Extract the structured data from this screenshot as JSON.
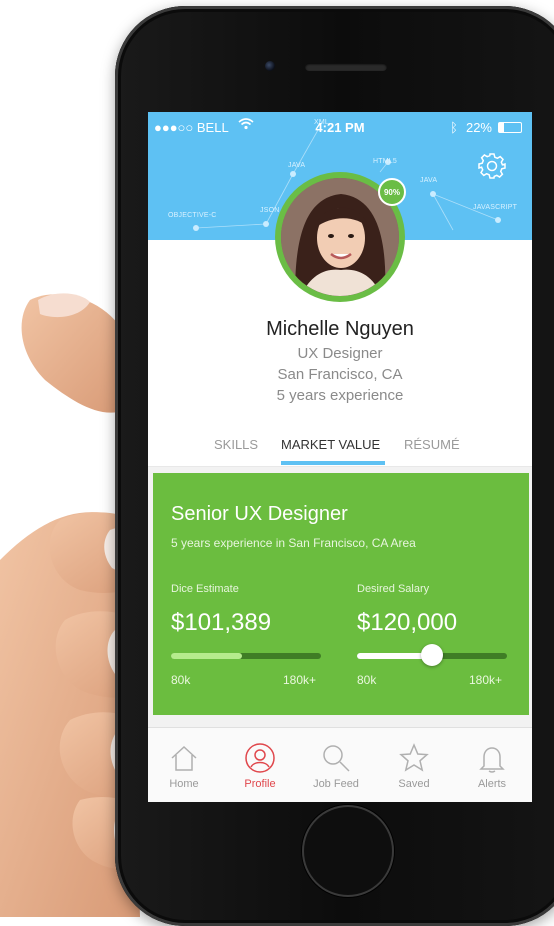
{
  "status_bar": {
    "carrier": "●●●○○ BELL",
    "time": "4:21 PM",
    "battery_text": "22%"
  },
  "skill_tags": [
    "XML",
    "JAVA",
    "HTML5",
    "JAVA",
    "OBJECTIVE-C",
    "JSON",
    "JAVASCRIPT"
  ],
  "profile": {
    "completion_badge": "90%",
    "name": "Michelle Nguyen",
    "job_title": "UX Designer",
    "location": "San Francisco, CA",
    "experience": "5 years experience"
  },
  "tabs": [
    {
      "label": "SKILLS",
      "active": false
    },
    {
      "label": "MARKET VALUE",
      "active": true
    },
    {
      "label": "RÉSUMÉ",
      "active": false
    }
  ],
  "market_card": {
    "heading": "Senior UX Designer",
    "subheading": "5 years experience in San Francisco, CA Area",
    "dice_estimate_label": "Dice Estimate",
    "dice_estimate_value": "$101,389",
    "dice_estimate_fraction": 0.47,
    "desired_salary_label": "Desired Salary",
    "desired_salary_value": "$120,000",
    "desired_salary_fraction": 0.5,
    "range_min": "80k",
    "range_max": "180k+"
  },
  "bottom_nav": [
    {
      "label": "Home",
      "icon": "home-icon",
      "active": false
    },
    {
      "label": "Profile",
      "icon": "profile-icon",
      "active": true
    },
    {
      "label": "Job Feed",
      "icon": "search-icon",
      "active": false
    },
    {
      "label": "Saved",
      "icon": "star-icon",
      "active": false
    },
    {
      "label": "Alerts",
      "icon": "bell-icon",
      "active": false
    }
  ],
  "colors": {
    "header_blue": "#5ec1f3",
    "card_green": "#6bbd3f",
    "active_red": "#e0474c"
  }
}
